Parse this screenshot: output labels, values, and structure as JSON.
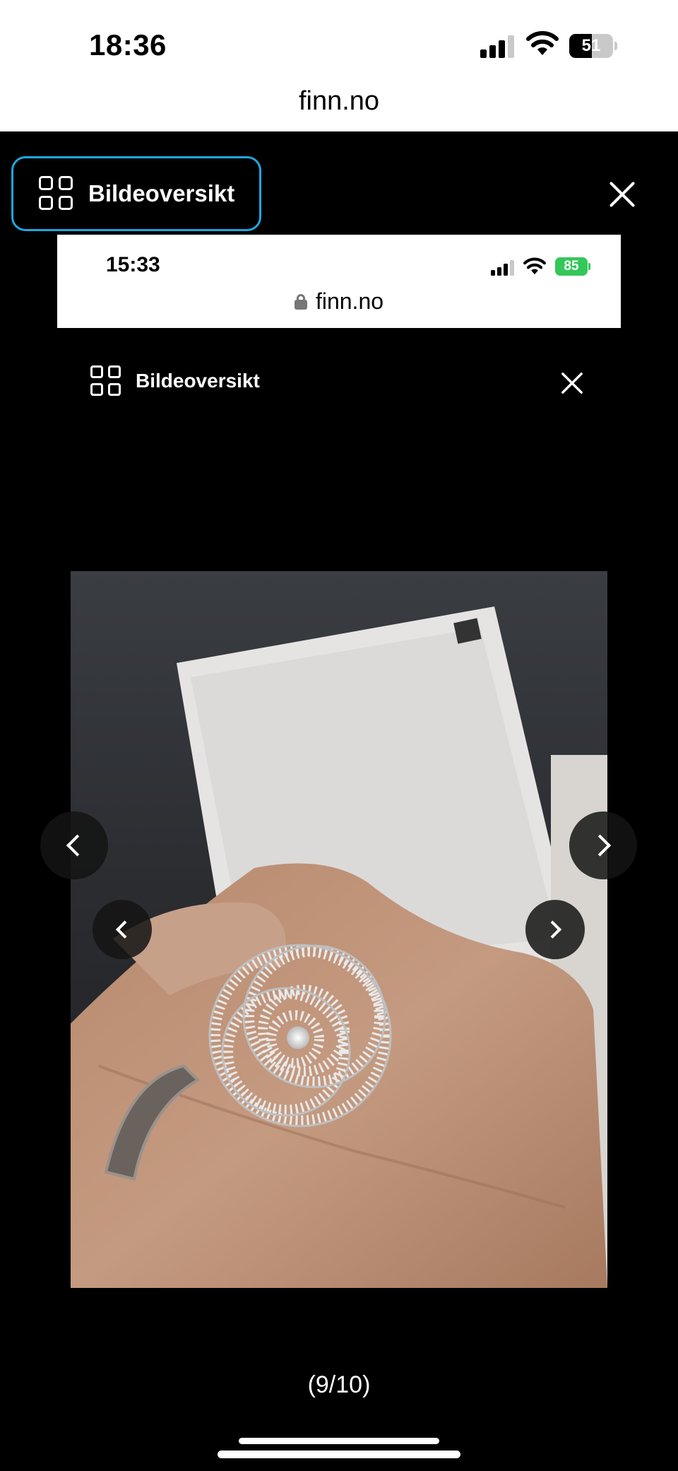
{
  "outer_status": {
    "time": "18:36",
    "battery": "51",
    "battery_level": 0.51
  },
  "outer_url": "finn.no",
  "viewer": {
    "overview_label": "Bildeoversikt"
  },
  "inner_status": {
    "time": "15:33",
    "battery": "85",
    "url": "finn.no"
  },
  "inner_viewer": {
    "overview_label": "Bildeoversikt"
  },
  "image_counter": "(9/10)",
  "colors": {
    "focus_ring": "#1ea7e0",
    "inner_battery": "#34c759",
    "background": "#000000"
  },
  "icons": [
    "grid-icon",
    "close-icon",
    "chevron-left-icon",
    "chevron-right-icon",
    "wifi-icon",
    "signal-icon",
    "battery-icon",
    "lock-icon"
  ]
}
